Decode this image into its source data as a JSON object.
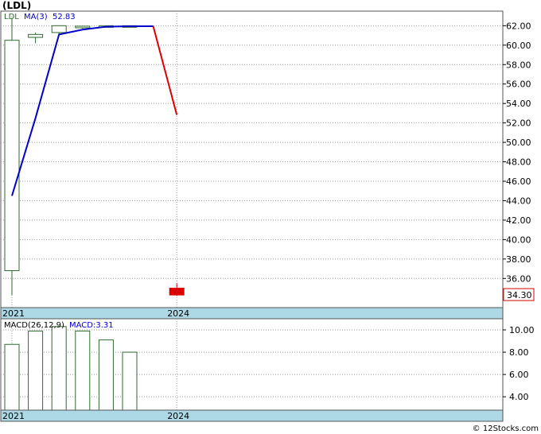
{
  "title": "(LDL)",
  "copyright": "© 12Stocks.com",
  "colors": {
    "up": "#2e6b2e",
    "down": "#dd0000",
    "ma_up": "#0000cc",
    "ma_down": "#dd0000",
    "axis_band": "#add8e6",
    "price_box": "#dd0000",
    "grid": "#999999"
  },
  "chart_data": [
    {
      "type": "candlestick",
      "symbol_label": "LDL",
      "ma_label": "MA(3)",
      "ma_value_label": "52.83",
      "last_price_label": "34.30",
      "ylim": [
        33.0,
        63.5
      ],
      "yticks": [
        "36.00",
        "38.00",
        "40.00",
        "42.00",
        "44.00",
        "46.00",
        "48.00",
        "50.00",
        "52.00",
        "54.00",
        "56.00",
        "58.00",
        "60.00",
        "62.00"
      ],
      "x_labels": [
        {
          "label": "2021",
          "index": 0
        },
        {
          "label": "2024",
          "index": 7
        }
      ],
      "candles": [
        {
          "open": 36.8,
          "high": 62.8,
          "low": 34.3,
          "close": 60.5
        },
        {
          "open": 60.8,
          "high": 61.3,
          "low": 60.2,
          "close": 61.1
        },
        {
          "open": 61.3,
          "high": 62.0,
          "low": 61.1,
          "close": 62.0
        },
        {
          "open": 61.9,
          "high": 62.0,
          "low": 61.7,
          "close": 61.95
        },
        {
          "open": 62.0,
          "high": 62.0,
          "low": 61.9,
          "close": 62.0
        },
        {
          "open": 62.0,
          "high": 62.0,
          "low": 61.95,
          "close": 62.0
        },
        null,
        {
          "open": 35.0,
          "high": 35.5,
          "low": 34.2,
          "close": 34.3
        }
      ],
      "ma": [
        44.5,
        52.5,
        61.1,
        61.6,
        61.9,
        61.95,
        61.95,
        52.83
      ]
    },
    {
      "type": "bar",
      "label": "MACD(26,12,9)",
      "value_label": "MACD:3.31",
      "ylim": [
        2.8,
        11.0
      ],
      "yticks": [
        "4.00",
        "6.00",
        "8.00",
        "10.00"
      ],
      "x_labels": [
        {
          "label": "2021",
          "index": 0
        },
        {
          "label": "2024",
          "index": 7
        }
      ],
      "values": [
        8.7,
        9.9,
        10.3,
        9.9,
        9.1,
        8.0,
        null,
        null
      ]
    }
  ]
}
